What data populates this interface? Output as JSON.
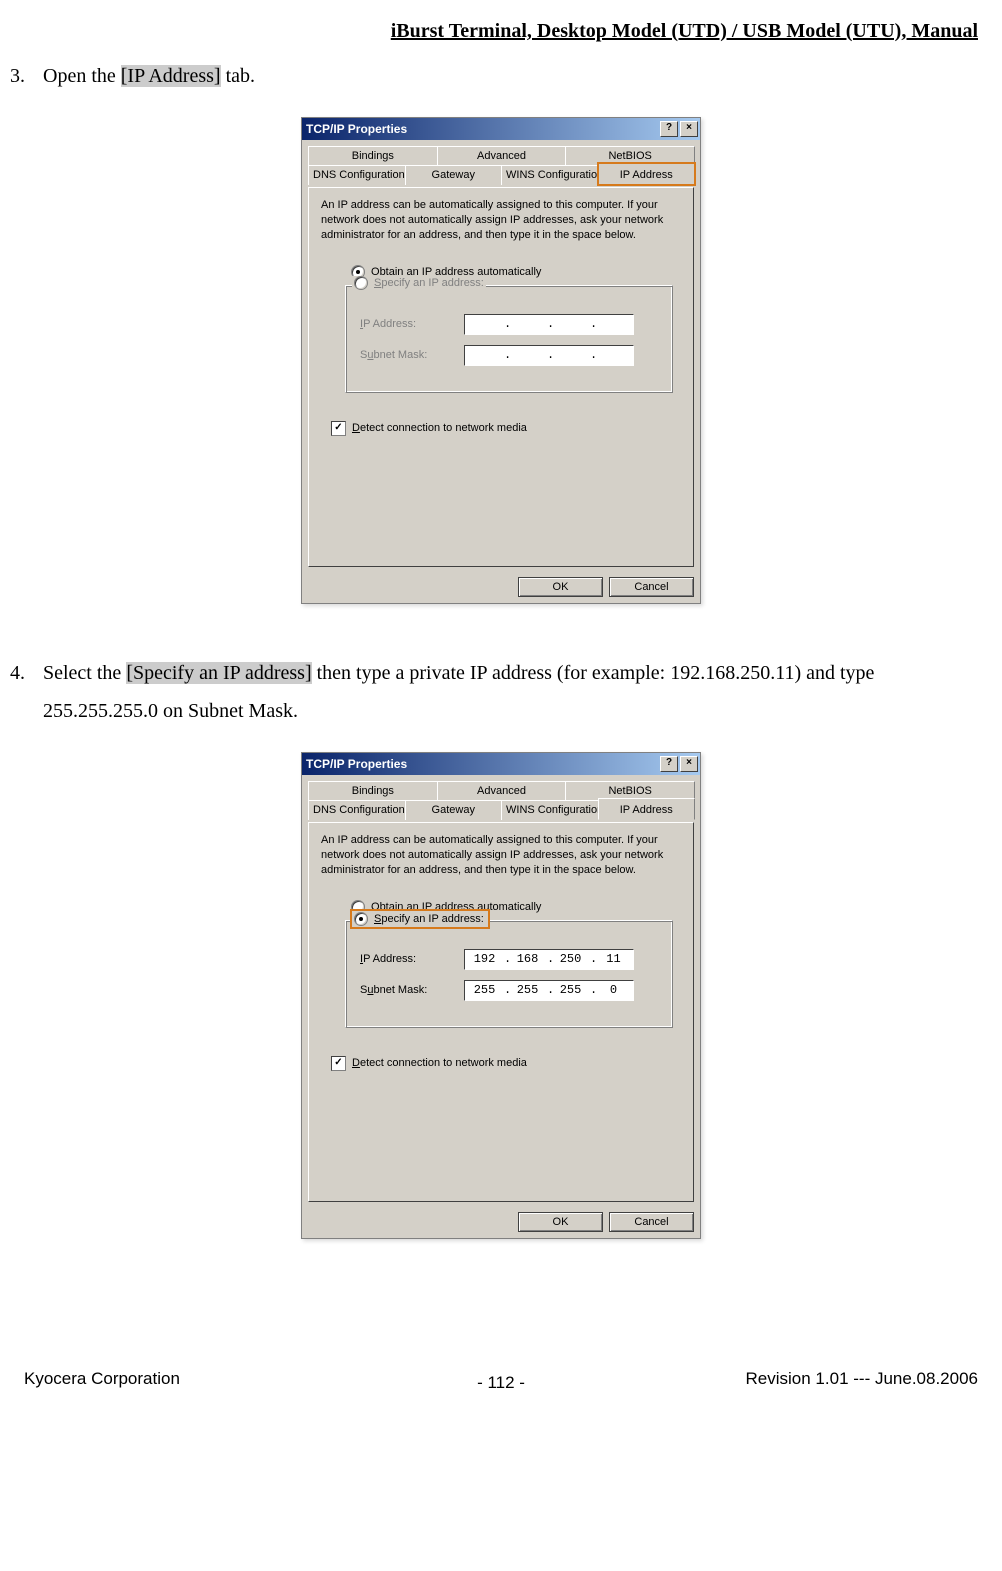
{
  "header": "iBurst Terminal, Desktop Model (UTD) / USB Model (UTU), Manual",
  "step3": {
    "num": "3.",
    "before": "Open the ",
    "hl": "[IP Address]",
    "after": " tab."
  },
  "step4": {
    "num": "4.",
    "before": "Select the ",
    "hl": "[Specify an IP address]",
    "after": " then type a private IP address (for example: 192.168.250.11) and type 255.255.255.0 on Subnet Mask."
  },
  "dialog": {
    "title": "TCP/IP Properties",
    "help": "?",
    "close": "×",
    "tabs_row1": [
      "Bindings",
      "Advanced",
      "NetBIOS"
    ],
    "tabs_row2": [
      "DNS Configuration",
      "Gateway",
      "WINS Configuration",
      "IP Address"
    ],
    "desc": "An IP address can be automatically assigned to this computer. If your network does not automatically assign IP addresses, ask your network administrator for an address, and then type it in the space below.",
    "radio_obtain_pre": "O",
    "radio_obtain_rest": "btain an IP address automatically",
    "radio_specify_pre": "S",
    "radio_specify_rest": "pecify an IP address:",
    "ip_label_pre": "I",
    "ip_label_rest": "P Address:",
    "sm_label_pre": "u",
    "sm_label_before": "S",
    "sm_label_rest": "bnet Mask:",
    "detect_pre": "D",
    "detect_rest": "etect connection to network media",
    "ok": "OK",
    "cancel": "Cancel",
    "checkmark": "✓"
  },
  "fig1": {
    "obtain_selected": true,
    "specify_selected": false,
    "ip": [
      "",
      "",
      "",
      ""
    ],
    "sm": [
      "",
      "",
      "",
      ""
    ]
  },
  "fig2": {
    "obtain_selected": false,
    "specify_selected": true,
    "ip": [
      "192",
      "168",
      "250",
      "11"
    ],
    "sm": [
      "255",
      "255",
      "255",
      "0"
    ]
  },
  "footer": {
    "left": "Kyocera Corporation",
    "center": "- 112 -",
    "right": "Revision 1.01 --- June.08.2006"
  }
}
